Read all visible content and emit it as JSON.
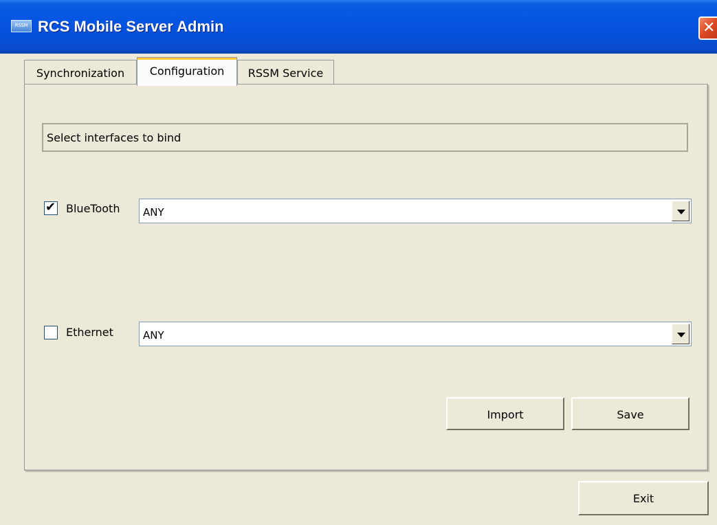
{
  "window": {
    "title": "RCS Mobile Server Admin",
    "icon_label": "RSSM",
    "close_glyph": "✕"
  },
  "tabs": [
    {
      "label": "Synchronization",
      "active": false
    },
    {
      "label": "Configuration",
      "active": true
    },
    {
      "label": "RSSM Service",
      "active": false
    }
  ],
  "configuration": {
    "info_text": "Select interfaces to bind",
    "bluetooth": {
      "label": "BlueTooth",
      "checked": true,
      "selected": "ANY"
    },
    "ethernet": {
      "label": "Ethernet",
      "checked": false,
      "selected": "ANY"
    },
    "check_glyph": "✔",
    "import_label": "Import",
    "save_label": "Save"
  },
  "footer": {
    "exit_label": "Exit"
  },
  "colors": {
    "titlebar": "#0554e3",
    "window_bg": "#ece9d8",
    "close_button": "#dc4a22"
  }
}
